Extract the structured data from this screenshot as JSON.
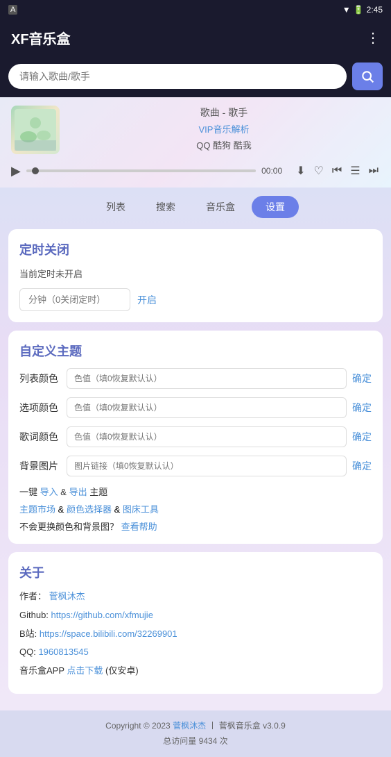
{
  "statusBar": {
    "appIcon": "A",
    "time": "2:45",
    "icons": [
      "wifi",
      "signal",
      "battery"
    ]
  },
  "topBar": {
    "title": "XF音乐盒",
    "menuIcon": "⋮"
  },
  "search": {
    "placeholder": "请输入歌曲/歌手",
    "buttonIcon": "🔍"
  },
  "player": {
    "songTitle": "歌曲 - 歌手",
    "vipLabel": "VIP音乐解析",
    "sources": "QQ 酷狗 酷我",
    "time": "00:00",
    "controls": {
      "download": "⬇",
      "favorite": "♡",
      "prev": "⏮",
      "list": "☰",
      "next": "⏭"
    }
  },
  "tabs": [
    {
      "id": "list",
      "label": "列表"
    },
    {
      "id": "search",
      "label": "搜索"
    },
    {
      "id": "musicbox",
      "label": "音乐盒"
    },
    {
      "id": "settings",
      "label": "设置",
      "active": true
    }
  ],
  "timer": {
    "title": "定时关闭",
    "subtitle": "当前定时未开启",
    "inputPlaceholder": "分钟（0关闭定时）",
    "buttonLabel": "开启"
  },
  "theme": {
    "title": "自定义主题",
    "rows": [
      {
        "label": "列表颜色",
        "placeholder": "色值（填0恢复默认认）",
        "confirmLabel": "确定"
      },
      {
        "label": "选项颜色",
        "placeholder": "色值（填0恢复默认认）",
        "confirmLabel": "确定"
      },
      {
        "label": "歌词颜色",
        "placeholder": "色值（填0恢复默认认）",
        "confirmLabel": "确定"
      },
      {
        "label": "背景图片",
        "placeholder": "图片链接（填0恢复默认认）",
        "confirmLabel": "确定"
      }
    ],
    "oneKey": "一键",
    "importLabel": "导入",
    "andText": "&",
    "exportLabel": "导出",
    "themeText": "主题",
    "marketLabel": "主题市场",
    "andText2": "&",
    "colorPickerLabel": "颜色选择器",
    "andText3": "&",
    "bedToolLabel": "图床工具",
    "noChangeText": "不会更换颜色和背景图？",
    "helpLabel": "查看帮助"
  },
  "about": {
    "title": "关于",
    "authorLabel": "作者：",
    "authorName": "菅枫沐杰",
    "authorLink": "菅枫沐杰",
    "githubLabel": "Github: ",
    "githubUrl": "https://github.com/xfmujie",
    "biliLabel": "B站: ",
    "biliUrl": "https://space.bilibili.com/32269901",
    "qqLabel": "QQ: ",
    "qqNumber": "1960813545",
    "appLabel": "音乐盒APP",
    "downloadLabel": "点击下载",
    "downloadSuffix": "(仅安卓)"
  },
  "footer": {
    "copyright": "Copyright © 2023",
    "authorLink": "菅枫沐杰",
    "separator": "丨",
    "appName": "菅枫音乐盒 v3.0.9",
    "visitLabel": "总访问量",
    "visitCount": "9434",
    "visitUnit": "次"
  }
}
